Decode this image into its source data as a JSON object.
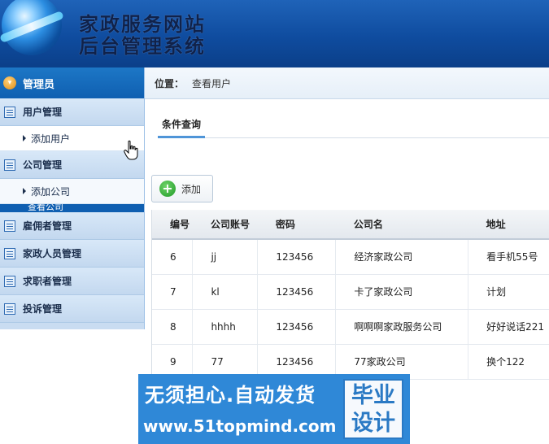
{
  "header": {
    "title_line1": "家政服务网站",
    "title_line2": "后台管理系统"
  },
  "sidebar": {
    "head": "管理员",
    "groups": [
      {
        "label": "用户管理",
        "sub": "添加用户"
      },
      {
        "label": "公司管理",
        "sub": "添加公司"
      },
      {
        "label": "雇佣者管理"
      },
      {
        "label": "家政人员管理"
      },
      {
        "label": "求职者管理"
      },
      {
        "label": "投诉管理"
      }
    ],
    "cut_sub": "查看公司"
  },
  "breadcrumb": {
    "label": "位置：",
    "value": "查看用户"
  },
  "tab": {
    "label": "条件查询"
  },
  "toolbar": {
    "add_label": "添加"
  },
  "table": {
    "headers": [
      "编号",
      "公司账号",
      "密码",
      "公司名",
      "地址"
    ],
    "rows": [
      [
        "6",
        "jj",
        "123456",
        "经济家政公司",
        "看手机55号"
      ],
      [
        "7",
        "kl",
        "123456",
        "卡了家政公司",
        "计划"
      ],
      [
        "8",
        "hhhh",
        "123456",
        "啊啊啊家政服务公司",
        "好好说话221"
      ],
      [
        "9",
        "77",
        "123456",
        "77家政公司",
        "换个122"
      ]
    ]
  },
  "watermark": {
    "line1": "无须担心.自动发货",
    "line2": "www.51topmind.com",
    "seal": "毕业设计"
  },
  "colors": {
    "header_blue": "#0f4c9f",
    "sidebar_bg": "#c9dcf1",
    "tab_accent": "#4f95d8",
    "watermark_blue": "#2f88d7"
  }
}
